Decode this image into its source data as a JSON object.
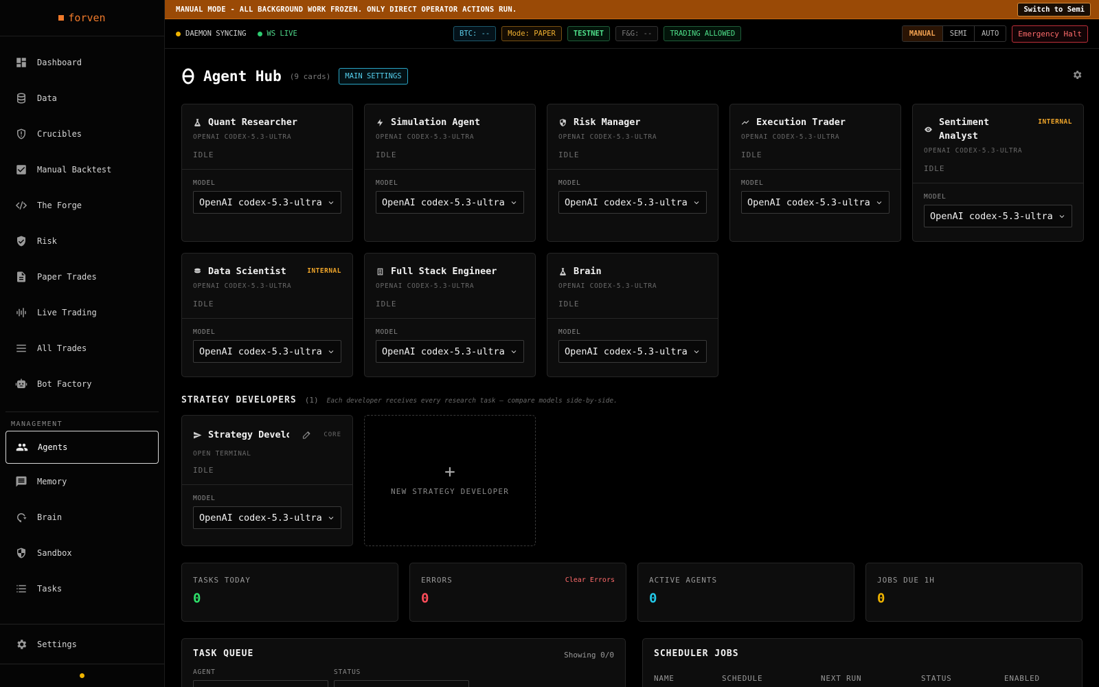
{
  "brand": {
    "name": "forven"
  },
  "sidebar": {
    "items": [
      {
        "label": "Dashboard",
        "icon": "dashboard-icon"
      },
      {
        "label": "Data",
        "icon": "database-icon"
      },
      {
        "label": "Crucibles",
        "icon": "shield-alert-icon"
      },
      {
        "label": "Manual Backtest",
        "icon": "check-square-icon"
      },
      {
        "label": "The Forge",
        "icon": "code-icon"
      },
      {
        "label": "Risk",
        "icon": "shield-check-icon"
      },
      {
        "label": "Paper Trades",
        "icon": "document-icon"
      },
      {
        "label": "Live Trading",
        "icon": "bars-icon"
      },
      {
        "label": "All Trades",
        "icon": "list-icon"
      },
      {
        "label": "Bot Factory",
        "icon": "robot-icon"
      }
    ],
    "section_label": "MANAGEMENT",
    "management": [
      {
        "label": "Agents",
        "icon": "users-icon",
        "active": true
      },
      {
        "label": "Memory",
        "icon": "chat-icon"
      },
      {
        "label": "Brain",
        "icon": "brain-icon"
      },
      {
        "label": "Sandbox",
        "icon": "shield-half-icon"
      },
      {
        "label": "Tasks",
        "icon": "tasks-icon"
      }
    ],
    "settings_label": "Settings"
  },
  "banner": {
    "text": "MANUAL MODE - ALL BACKGROUND WORK FROZEN. ONLY DIRECT OPERATOR ACTIONS RUN.",
    "button": "Switch to Semi"
  },
  "status": {
    "daemon": "DAEMON SYNCING",
    "ws": "WS LIVE",
    "btc": "BTC: --",
    "mode": "Mode: PAPER",
    "net": "TESTNET",
    "fg": "F&G: --",
    "trading": "TRADING ALLOWED",
    "modes": [
      "MANUAL",
      "SEMI",
      "AUTO"
    ],
    "halt": "Emergency Halt",
    "colors": {
      "daemon": "#f0b400",
      "ws": "#2ecc71"
    }
  },
  "hub": {
    "title": "Agent Hub",
    "count": "(9 cards)",
    "main_settings": "MAIN SETTINGS"
  },
  "agents": [
    {
      "name": "Quant Researcher",
      "icon": "flask-icon",
      "sub": "OPENAI CODEX-5.3-ULTRA",
      "status": "IDLE",
      "model_label": "MODEL",
      "model": "OpenAI codex-5.3-ultra"
    },
    {
      "name": "Simulation Agent",
      "icon": "bolt-icon",
      "sub": "OPENAI CODEX-5.3-ULTRA",
      "status": "IDLE",
      "model_label": "MODEL",
      "model": "OpenAI codex-5.3-ultra"
    },
    {
      "name": "Risk Manager",
      "icon": "shield-icon",
      "sub": "OPENAI CODEX-5.3-ULTRA",
      "status": "IDLE",
      "model_label": "MODEL",
      "model": "OpenAI codex-5.3-ultra"
    },
    {
      "name": "Execution Trader",
      "icon": "trend-icon",
      "sub": "OPENAI CODEX-5.3-ULTRA",
      "status": "IDLE",
      "model_label": "MODEL",
      "model": "OpenAI codex-5.3-ultra"
    },
    {
      "name": "Sentiment Analyst",
      "icon": "eye-icon",
      "badge": "INTERNAL",
      "sub": "OPENAI CODEX-5.3-ULTRA",
      "status": "IDLE",
      "model_label": "MODEL",
      "model": "OpenAI codex-5.3-ultra"
    },
    {
      "name": "Data Scientist",
      "icon": "db-icon",
      "badge": "INTERNAL",
      "sub": "OPENAI CODEX-5.3-ULTRA",
      "status": "IDLE",
      "model_label": "MODEL",
      "model": "OpenAI codex-5.3-ultra"
    },
    {
      "name": "Full Stack Engineer",
      "icon": "file-icon",
      "sub": "OPENAI CODEX-5.3-ULTRA",
      "status": "IDLE",
      "model_label": "MODEL",
      "model": "OpenAI codex-5.3-ultra"
    },
    {
      "name": "Brain",
      "icon": "flask-icon",
      "sub": "OPENAI CODEX-5.3-ULTRA",
      "status": "IDLE",
      "model_label": "MODEL",
      "model": "OpenAI codex-5.3-ultra"
    }
  ],
  "strategy": {
    "title": "STRATEGY DEVELOPERS",
    "count": "(1)",
    "note": "Each developer receives every research task — compare models side-by-side.",
    "dev": {
      "name": "Strategy Developer",
      "badge": "CORE",
      "sub": "OPEN TERMINAL",
      "status": "IDLE",
      "model_label": "MODEL",
      "model": "OpenAI codex-5.3-ultra"
    },
    "new_label": "NEW STRATEGY DEVELOPER"
  },
  "stats": [
    {
      "label": "TASKS TODAY",
      "value": "0",
      "color": "#2ee06a"
    },
    {
      "label": "ERRORS",
      "value": "0",
      "color": "#ff4d5a",
      "link": "Clear Errors"
    },
    {
      "label": "ACTIVE AGENTS",
      "value": "0",
      "color": "#22c8e8"
    },
    {
      "label": "JOBS DUE 1H",
      "value": "0",
      "color": "#f0b400"
    }
  ],
  "task_queue": {
    "title": "TASK QUEUE",
    "showing": "Showing 0/0",
    "filters": [
      "AGENT",
      "STATUS"
    ]
  },
  "scheduler": {
    "title": "SCHEDULER JOBS",
    "columns": [
      "NAME",
      "SCHEDULE",
      "NEXT RUN",
      "STATUS",
      "ENABLED"
    ]
  }
}
